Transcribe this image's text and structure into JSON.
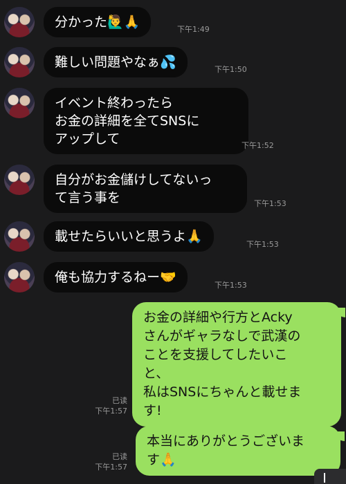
{
  "incoming": [
    {
      "text": "分かった🙋‍♂️🙏",
      "time": "下午1:49"
    },
    {
      "text": "難しい問題やなぁ💦",
      "time": "下午1:50"
    },
    {
      "text": "イベント終わったら\nお金の詳細を全てSNSに\nアップして",
      "time": "下午1:52"
    },
    {
      "text": "自分がお金儲けしてないっ\nて言う事を",
      "time": "下午1:53"
    },
    {
      "text": "載せたらいいと思うよ🙏",
      "time": "下午1:53"
    },
    {
      "text": "俺も協力するねー🤝",
      "time": "下午1:53"
    }
  ],
  "outgoing": [
    {
      "text": "お金の詳細や行方とAcky\nさんがギャラなしで武漢の\nことを支援してしたいこ\nと、\n私はSNSにちゃんと載せま\nす!",
      "read": "已读",
      "time": "下午1:57"
    },
    {
      "text": "本当にありがとうございま\nす🙏",
      "read": "已读",
      "time": "下午1:57"
    }
  ],
  "colors": {
    "background": "#1b1b1c",
    "incoming_bubble": "#0b0b0b",
    "outgoing_bubble": "#9ae060",
    "meta_text": "#9a9a9a"
  }
}
